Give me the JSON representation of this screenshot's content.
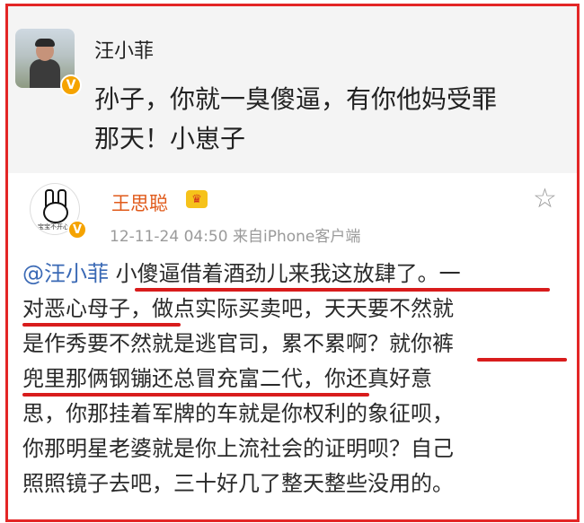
{
  "top_post": {
    "author": "汪小菲",
    "verified_badge": "V",
    "text": "孙子，你就一臭傻逼，有你他妈受罪那天！小崽子",
    "text_lines": [
      "孙子，你就一臭傻逼，有你他妈受罪",
      "那天！小崽子"
    ]
  },
  "reply": {
    "author": "王思聪",
    "verified_badge": "V",
    "avatar_caption": "宝宝不开心",
    "crown_glyph": "♛",
    "timestamp": "12-11-24 04:50",
    "source": "来自iPhone客户端",
    "star_glyph": "☆",
    "mention": "@汪小菲",
    "lines": [
      "小傻逼借着酒劲儿来我这放肆了。一",
      "对恶心母子，做点实际买卖吧，天天要不然就",
      "是作秀要不然就是逃官司，累不累啊？就你裤",
      "兜里那俩钢镚还总冒充富二代，你还真好意",
      "思，你那挂着军牌的车就是你权利的象征呗，",
      "你那明星老婆就是你上流社会的证明呗？自己",
      "照照镜子去吧，三十好几了整天整些没用的。"
    ]
  },
  "colors": {
    "frame_border": "#e32626",
    "underline": "#d81c1c",
    "mention": "#3a69b5",
    "author_name": "#e05a1a",
    "meta_text": "#9a9a9a",
    "verified_badge": "#f5a300"
  },
  "icons": [
    "verified-badge-icon",
    "crown-icon",
    "star-icon"
  ]
}
